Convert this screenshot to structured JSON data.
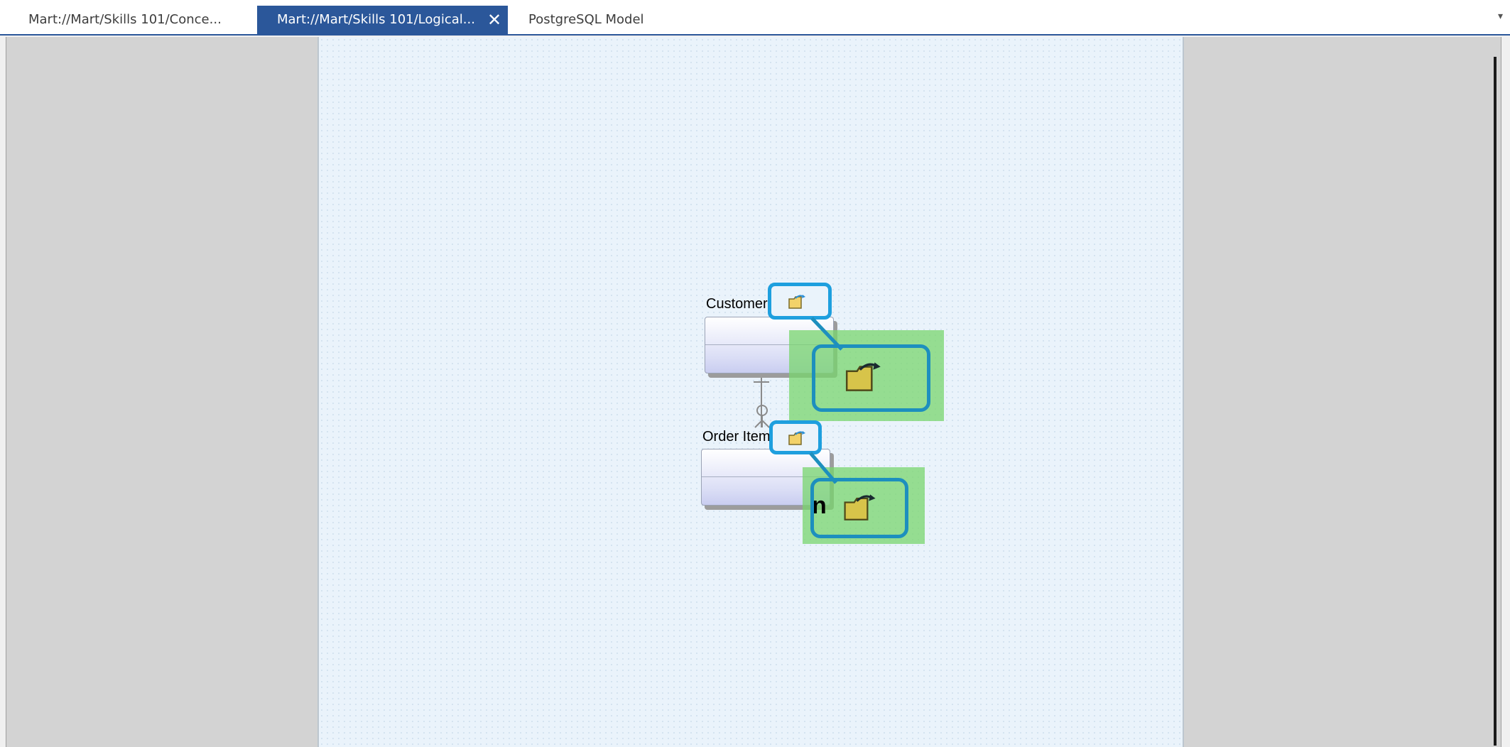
{
  "tabs": [
    {
      "label": "Mart://Mart/Skills 101/Conce...",
      "active": false
    },
    {
      "label": "Mart://Mart/Skills 101/Logical...",
      "active": true,
      "close_glyph": "✕"
    },
    {
      "label": "PostgreSQL Model",
      "active": false
    }
  ],
  "tab_overflow_glyph": "▾",
  "diagram": {
    "entities": [
      {
        "name": "Customer",
        "icon": "open-folder-arrow-icon"
      },
      {
        "name": "Order Item",
        "icon": "open-folder-arrow-icon"
      }
    ],
    "hidden_text_fragment": "n"
  },
  "colors": {
    "active_tab": "#2b579a",
    "callout_border": "#1e9fde",
    "highlight": "#78d66e",
    "canvas": "#eaf3fb"
  }
}
